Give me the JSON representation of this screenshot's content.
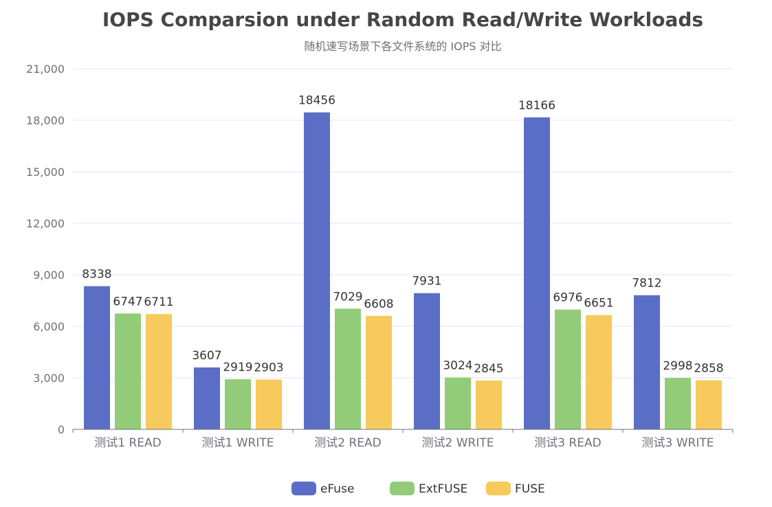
{
  "chart_data": {
    "type": "bar",
    "title": "IOPS Comparsion under Random Read/Write Workloads",
    "subtitle": "随机速写场景下各文件系统的 IOPS 对比",
    "categories": [
      "测试1 READ",
      "测试1 WRITE",
      "测试2 READ",
      "测试2 WRITE",
      "测试3 READ",
      "测试3 WRITE"
    ],
    "series": [
      {
        "name": "eFuse",
        "color": "#5b6ec6",
        "values": [
          8338,
          3607,
          18456,
          7931,
          18166,
          7812
        ]
      },
      {
        "name": "ExtFUSE",
        "color": "#93cc78",
        "values": [
          6747,
          2919,
          7029,
          3024,
          6976,
          2998
        ]
      },
      {
        "name": "FUSE",
        "color": "#f6ca5c",
        "values": [
          6711,
          2903,
          6608,
          2845,
          6651,
          2858
        ]
      }
    ],
    "ylim": [
      0,
      21000
    ],
    "yticks": [
      0,
      3000,
      6000,
      9000,
      12000,
      15000,
      18000,
      21000
    ],
    "ytick_labels": [
      "0",
      "3,000",
      "6,000",
      "9,000",
      "12,000",
      "15,000",
      "18,000",
      "21,000"
    ],
    "xlabel": "",
    "ylabel": "",
    "grid": true,
    "legend": "bottom-center",
    "show_data_labels": true
  }
}
